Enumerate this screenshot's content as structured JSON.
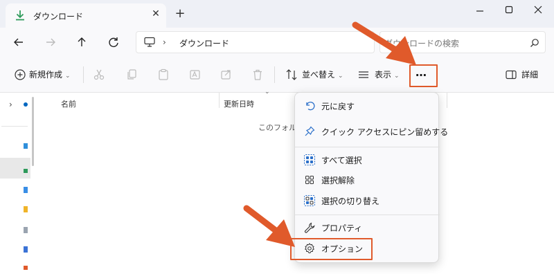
{
  "window": {
    "tab_title": "ダウンロード",
    "tab_close": "✕",
    "new_tab": "+"
  },
  "nav": {
    "breadcrumb_separator": "›",
    "breadcrumb": "ダウンロード",
    "search_placeholder": "ダウンロードの検索"
  },
  "toolbar": {
    "new_label": "新規作成",
    "sort_label": "並べ替え",
    "view_label": "表示",
    "more_label": "…",
    "details_label": "詳細"
  },
  "columns": {
    "name": "名前",
    "modified": "更新日時"
  },
  "empty_message": "このフォルダーは空です。",
  "menu": {
    "items": [
      {
        "label": "元に戻す",
        "icon": "undo-icon"
      },
      {
        "label": "クイック アクセスにピン留めする",
        "icon": "pin-icon"
      },
      {
        "label": "すべて選択",
        "icon": "select-all-icon"
      },
      {
        "label": "選択解除",
        "icon": "select-none-icon"
      },
      {
        "label": "選択の切り替え",
        "icon": "invert-selection-icon"
      },
      {
        "label": "プロパティ",
        "icon": "wrench-icon"
      },
      {
        "label": "オプション",
        "icon": "gear-icon"
      }
    ]
  },
  "colors": {
    "accent": "#0067c0",
    "highlight": "#e05a2b"
  }
}
